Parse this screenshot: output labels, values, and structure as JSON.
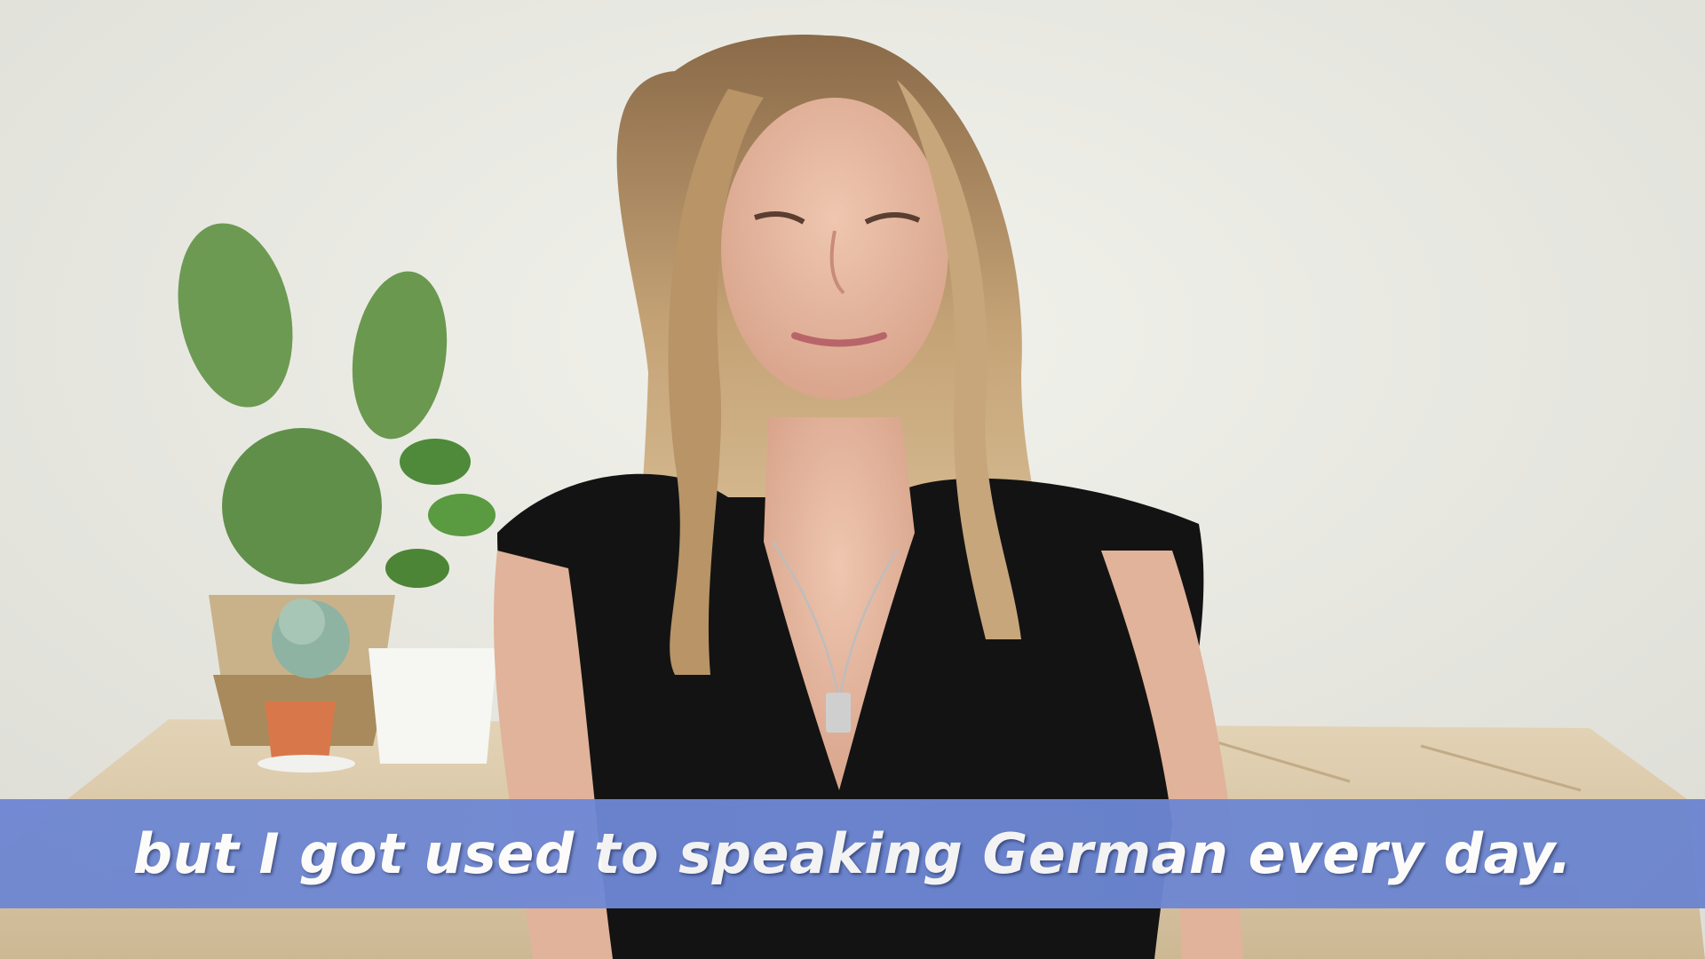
{
  "video": {
    "subtitle": "but I got used to speaking German every day."
  },
  "colors": {
    "subtitle_bar": "#6f89d6",
    "subtitle_text": "#ffffff",
    "wall": "#ecece6",
    "table": "#d9c7a8",
    "cactus": "#6a9a4f",
    "shirt": "#121212",
    "hair": "#c8a67a"
  },
  "icons": {
    "scene": "woman-speaking-to-camera",
    "plant": "cactus-and-succulent"
  }
}
